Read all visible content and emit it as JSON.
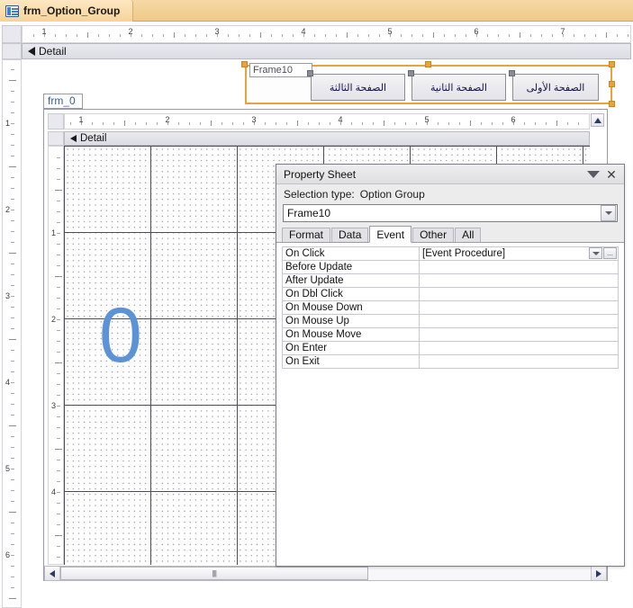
{
  "window": {
    "document_tab": {
      "label": "frm_Option_Group",
      "icon": "form-design-icon"
    }
  },
  "outer_form": {
    "ruler_horizontal": {
      "labels": [
        "1",
        "2",
        "3",
        "4",
        "5",
        "6",
        "7"
      ],
      "unit": "inch"
    },
    "ruler_vertical": {
      "labels": [
        "1",
        "2",
        "3",
        "4",
        "5",
        "6"
      ],
      "unit": "inch"
    },
    "section_header": {
      "label": "Detail",
      "collapse_icon": "section-arrow-icon"
    },
    "option_group": {
      "name_label": "Frame10",
      "selected": true,
      "selection_color": "#e8a33d",
      "buttons": [
        {
          "label": "الصفحة الثالثة",
          "name": "toggle-page-three"
        },
        {
          "label": "الصفحة الثانية",
          "name": "toggle-page-two"
        },
        {
          "label": "الصفحة الأولى",
          "name": "toggle-page-one"
        }
      ]
    },
    "subform": {
      "tag_label": "frm_0",
      "ruler_horizontal": {
        "labels": [
          "1",
          "2",
          "3",
          "4",
          "5",
          "6"
        ]
      },
      "ruler_vertical": {
        "labels": [
          "1",
          "2",
          "3",
          "4"
        ]
      },
      "section_header": {
        "label": "Detail"
      },
      "canvas_text": "0",
      "canvas_text_color": "#5b93d6",
      "hscrollbar": {
        "left_arrow": "scroll-left-icon",
        "right_arrow": "scroll-right-icon",
        "grip": "||||"
      },
      "vscroll_up": "scroll-up-icon"
    }
  },
  "property_sheet": {
    "title": "Property Sheet",
    "minimize_icon": "chevron-down-icon",
    "close_icon": "close-icon",
    "selection_type_label": "Selection type:",
    "selection_type_value": "Option Group",
    "object_combo": {
      "value": "Frame10",
      "dropdown_icon": "chevron-down-icon"
    },
    "tabs": [
      {
        "label": "Format",
        "active": false
      },
      {
        "label": "Data",
        "active": false
      },
      {
        "label": "Event",
        "active": true
      },
      {
        "label": "Other",
        "active": false
      },
      {
        "label": "All",
        "active": false
      }
    ],
    "active_tab": "Event",
    "properties": [
      {
        "name": "On Click",
        "value": "[Event Procedure]",
        "has_controls": true
      },
      {
        "name": "Before Update",
        "value": "",
        "has_controls": false
      },
      {
        "name": "After Update",
        "value": "",
        "has_controls": false
      },
      {
        "name": "On Dbl Click",
        "value": "",
        "has_controls": false
      },
      {
        "name": "On Mouse Down",
        "value": "",
        "has_controls": false
      },
      {
        "name": "On Mouse Up",
        "value": "",
        "has_controls": false
      },
      {
        "name": "On Mouse Move",
        "value": "",
        "has_controls": false
      },
      {
        "name": "On Enter",
        "value": "",
        "has_controls": false
      },
      {
        "name": "On Exit",
        "value": "",
        "has_controls": false
      }
    ],
    "value_dropdown_icon": "chevron-down-icon",
    "value_builder_icon": "ellipsis-icon",
    "builder_label": "..."
  }
}
